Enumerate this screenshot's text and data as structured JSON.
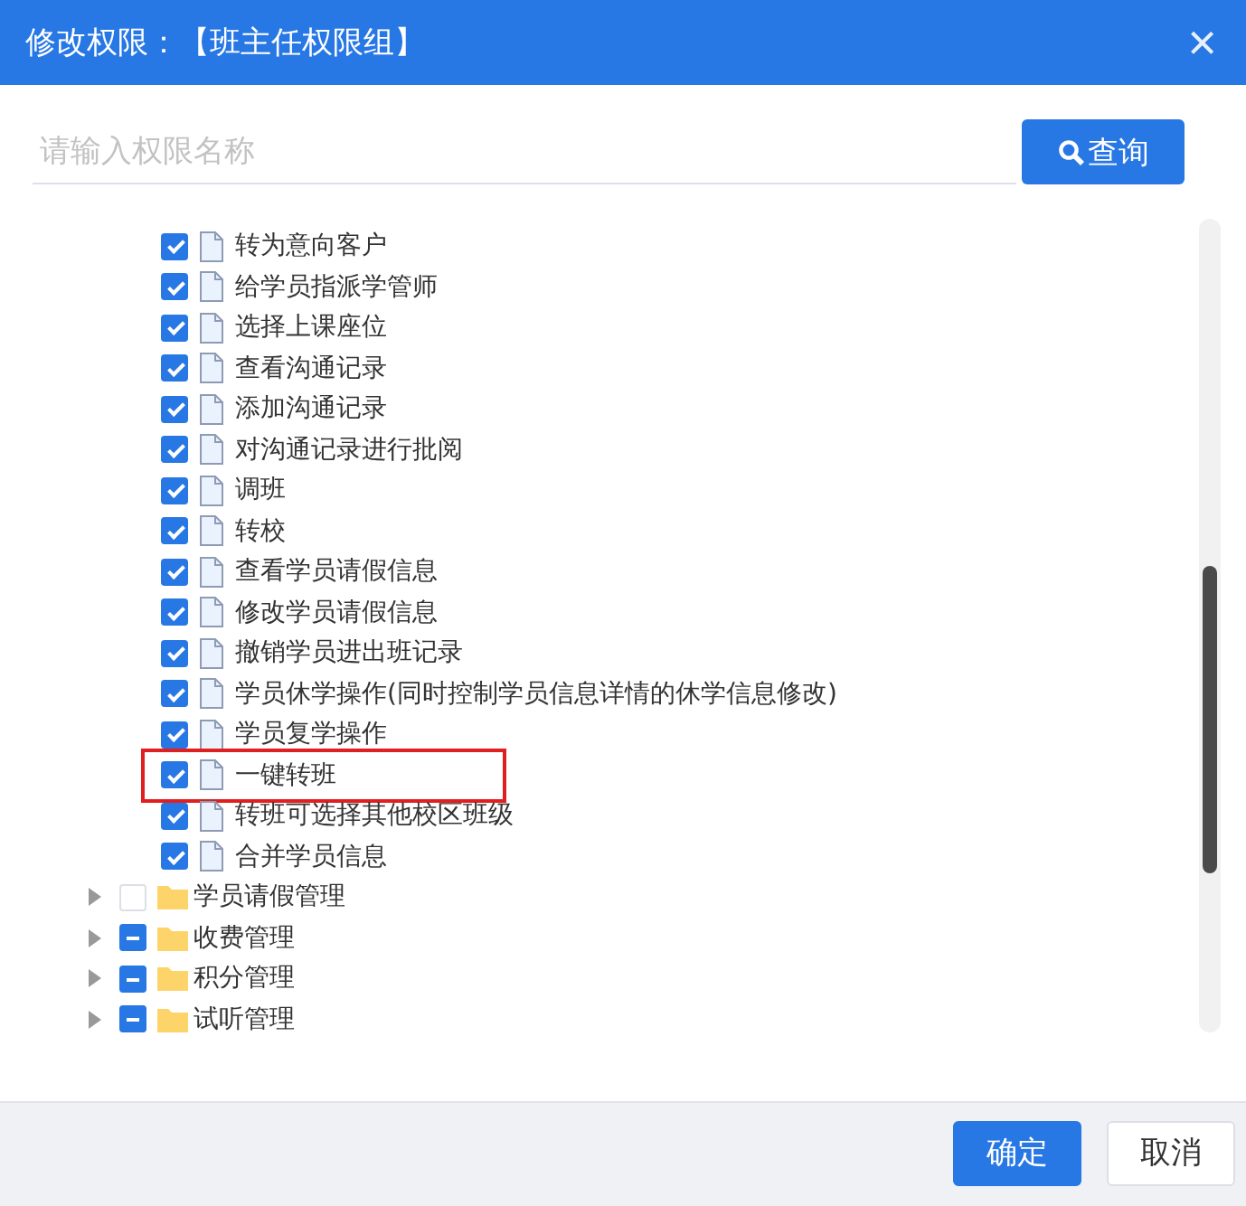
{
  "dialog": {
    "title": "修改权限：【班主任权限组】",
    "close": "×"
  },
  "search": {
    "placeholder": "请输入权限名称",
    "button": "查询"
  },
  "tree": [
    {
      "children": [
        {
          "label": "转为意向客户",
          "checked": true,
          "highlighted": false
        },
        {
          "label": "给学员指派学管师",
          "checked": true,
          "highlighted": false
        },
        {
          "label": "选择上课座位",
          "checked": true,
          "highlighted": false
        },
        {
          "label": "查看沟通记录",
          "checked": true,
          "highlighted": false
        },
        {
          "label": "添加沟通记录",
          "checked": true,
          "highlighted": false
        },
        {
          "label": "对沟通记录进行批阅",
          "checked": true,
          "highlighted": false
        },
        {
          "label": "调班",
          "checked": true,
          "highlighted": false
        },
        {
          "label": "转校",
          "checked": true,
          "highlighted": false
        },
        {
          "label": "查看学员请假信息",
          "checked": true,
          "highlighted": false
        },
        {
          "label": "修改学员请假信息",
          "checked": true,
          "highlighted": false
        },
        {
          "label": "撤销学员进出班记录",
          "checked": true,
          "highlighted": false
        },
        {
          "label": "学员休学操作(同时控制学员信息详情的休学信息修改)",
          "checked": true,
          "highlighted": false
        },
        {
          "label": "学员复学操作",
          "checked": true,
          "highlighted": false
        },
        {
          "label": "一键转班",
          "checked": true,
          "highlighted": true
        },
        {
          "label": "转班可选择其他校区班级",
          "checked": true,
          "highlighted": false
        },
        {
          "label": "合并学员信息",
          "checked": true,
          "highlighted": false
        }
      ]
    },
    {
      "label": "学员请假管理",
      "partial": false,
      "expanded": false
    },
    {
      "label": "收费管理",
      "partial": true,
      "expanded": false
    },
    {
      "label": "积分管理",
      "partial": true,
      "expanded": false
    },
    {
      "label": "试听管理",
      "partial": true,
      "expanded": false
    }
  ],
  "footer": {
    "buttons": [
      {
        "label": "确定",
        "kind": "primary"
      },
      {
        "label": "取消",
        "kind": "default"
      }
    ]
  }
}
